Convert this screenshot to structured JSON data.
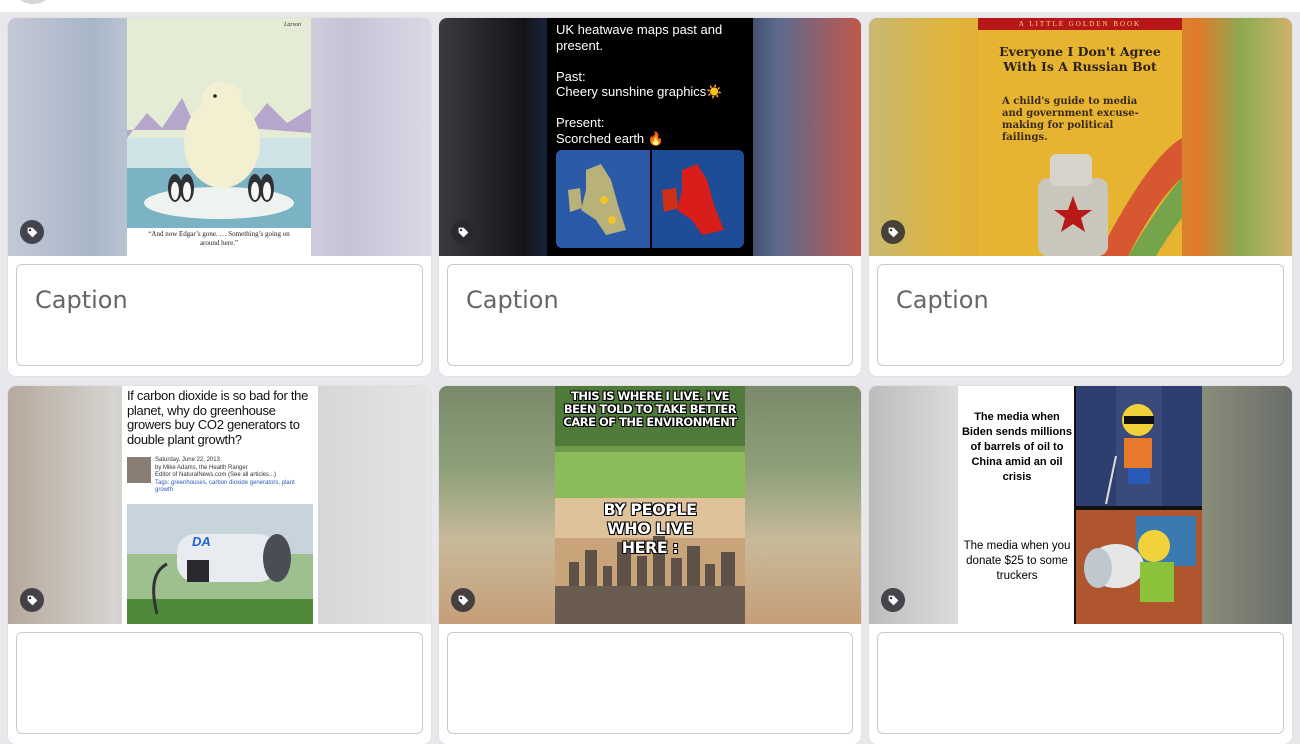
{
  "cards": [
    {
      "caption_placeholder": "Caption",
      "image": {
        "kind": "comic",
        "caption_text": "“And now Edgar’s gone. … Something’s going on around here.”",
        "signature": "Larson"
      }
    },
    {
      "caption_placeholder": "Caption",
      "image": {
        "kind": "text-post",
        "lines": [
          "UK heatwave maps past and",
          "present.",
          "",
          "Past:",
          "Cheery sunshine graphics☀️",
          "",
          "Present:",
          "Scorched earth 🔥"
        ]
      }
    },
    {
      "caption_placeholder": "Caption",
      "image": {
        "kind": "book-cover",
        "banner": "A LITTLE GOLDEN BOOK",
        "title": "Everyone I Don't Agree With Is A Russian Bot",
        "subtitle": "A child's guide to media and government excuse-making for political failings."
      }
    },
    {
      "caption_placeholder": "",
      "image": {
        "kind": "article",
        "question": "If carbon dioxide is so bad for the planet, why do greenhouse growers buy CO2 generators to double plant growth?",
        "date": "Saturday, June 22, 2013",
        "author": "by Mike Adams, the Health Ranger",
        "editor": "Editor of NaturalNews.com (See all articles...)",
        "tags": "Tags: greenhouses, carbon dioxide generators, plant growth",
        "generator_logo": "DA"
      }
    },
    {
      "caption_placeholder": "",
      "image": {
        "kind": "meme",
        "top_text": "THIS IS WHERE I LIVE. I'VE BEEN TOLD TO TAKE BETTER CARE OF THE ENVIRONMENT",
        "bottom_text": "BY PEOPLE WHO LIVE HERE :"
      }
    },
    {
      "caption_placeholder": "",
      "image": {
        "kind": "meme",
        "top_text": "The media when Biden sends millions of barrels of oil to China amid an oil crisis",
        "bottom_text": "The media when you donate $25 to some truckers"
      }
    }
  ],
  "icons": {
    "tag": "tag-icon"
  },
  "colors": {
    "tag_button": "#2a2a30",
    "caption_border": "#c9c9cf",
    "page_bg": "#e8e8ec"
  }
}
